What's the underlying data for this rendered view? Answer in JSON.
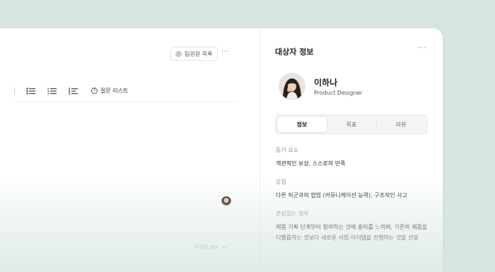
{
  "editor": {
    "member_button_label": "팀원원 목록",
    "more_label": "···",
    "question_list_label": "질문 리스트",
    "item_status_label": "아이템 상태"
  },
  "panel": {
    "title": "대상자 정보",
    "more_label": "···",
    "profile": {
      "name": "이하나",
      "role": "Product Designer"
    },
    "tabs": [
      {
        "label": "정보",
        "active": true
      },
      {
        "label": "목표",
        "active": false
      },
      {
        "label": "리뷰",
        "active": false
      }
    ],
    "sections": [
      {
        "label": "동기 요소",
        "value": "객관적인 보상, 스스로의 만족"
      },
      {
        "label": "강점",
        "value": "다른 직군과의 협업 (커뮤니케이션 능력), 구조적인 사고"
      },
      {
        "label": "관심있는 업무",
        "value": "제품 기획 단계부터 참여하는 것에 흥미를 느끼며, 기존의 제품을 디벨롭하는 것보다 새로운 사업 아이템을 진행하는 것을 선호"
      }
    ]
  },
  "colors": {
    "background": "#d6e5df",
    "card": "#ffffff",
    "muted_text": "#8e9593"
  },
  "icons": [
    "bullet-list-icon",
    "numbered-list-icon",
    "indent-list-icon",
    "question-circle-icon",
    "chevron-down-icon",
    "more-icon"
  ]
}
